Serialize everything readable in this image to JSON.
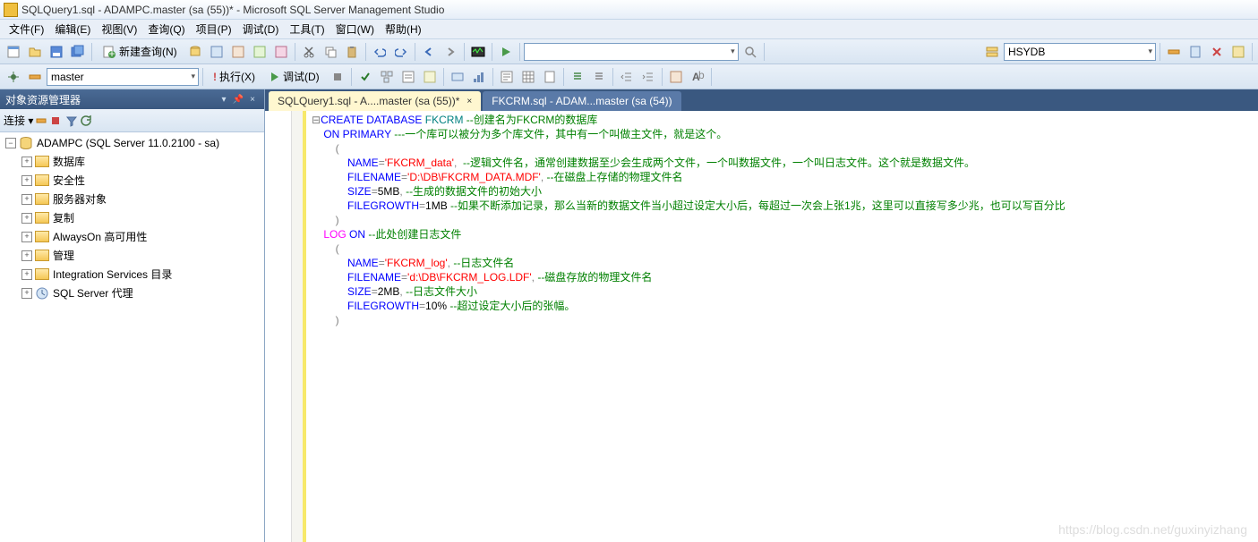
{
  "window": {
    "title": "SQLQuery1.sql - ADAMPC.master (sa (55))* - Microsoft SQL Server Management Studio"
  },
  "menu": {
    "file": "文件(F)",
    "edit": "编辑(E)",
    "view": "视图(V)",
    "query": "查询(Q)",
    "project": "项目(P)",
    "debug": "调试(D)",
    "tools": "工具(T)",
    "window": "窗口(W)",
    "help": "帮助(H)"
  },
  "toolbar1": {
    "new_query": "新建查询(N)",
    "db_combo": "HSYDB"
  },
  "toolbar2": {
    "db_context": "master",
    "execute": "执行(X)",
    "debug": "调试(D)"
  },
  "sidebar": {
    "title": "对象资源管理器",
    "connect_label": "连接 ▾",
    "server": "ADAMPC (SQL Server 11.0.2100 - sa)",
    "nodes": {
      "databases": "数据库",
      "security": "安全性",
      "server_objects": "服务器对象",
      "replication": "复制",
      "alwayson": "AlwaysOn 高可用性",
      "management": "管理",
      "integration": "Integration Services 目录",
      "agent": "SQL Server 代理"
    }
  },
  "tabs": {
    "active": "SQLQuery1.sql - A....master (sa (55))*",
    "inactive": "FKCRM.sql - ADAM...master (sa (54))"
  },
  "code": {
    "l1_create": "CREATE",
    "l1_database": " DATABASE",
    "l1_fkcrm": " FKCRM",
    "l1_c": " --创建名为FKCRM的数据库",
    "l2_on": "ON",
    "l2_primary": " PRIMARY",
    "l2_c": " ---一个库可以被分为多个库文件，其中有一个叫做主文件，就是这个。",
    "l3": "(",
    "l4_name": "NAME",
    "l4_eq": "=",
    "l4_val": "'FKCRM_data'",
    "l4_comma": ",",
    "l4_c": "  --逻辑文件名，通常创建数据至少会生成两个文件，一个叫数据文件，一个叫日志文件。这个就是数据文件。",
    "l5_fn": "FILENAME",
    "l5_eq": "=",
    "l5_val": "'D:\\DB\\FKCRM_DATA.MDF'",
    "l5_comma": ",",
    "l5_c": " --在磁盘上存储的物理文件名",
    "l6_size": "SIZE",
    "l6_eq": "=",
    "l6_val": "5MB",
    "l6_comma": ",",
    "l6_c": " --生成的数据文件的初始大小",
    "l7_fg": "FILEGROWTH",
    "l7_eq": "=",
    "l7_val": "1MB",
    "l7_c": " --如果不断添加记录，那么当新的数据文件当小超过设定大小后，每超过一次会上张1兆，这里可以直接写多少兆，也可以写百分比",
    "l8": ")",
    "l9_log": "LOG",
    "l9_on": " ON",
    "l9_c": " --此处创建日志文件",
    "l10": "(",
    "l11_name": "NAME",
    "l11_eq": "=",
    "l11_val": "'FKCRM_log'",
    "l11_comma": ",",
    "l11_c": " --日志文件名",
    "l12_fn": "FILENAME",
    "l12_eq": "=",
    "l12_val": "'d:\\DB\\FKCRM_LOG.LDF'",
    "l12_comma": ",",
    "l12_c": " --磁盘存放的物理文件名",
    "l13_size": "SIZE",
    "l13_eq": "=",
    "l13_val": "2MB",
    "l13_comma": ",",
    "l13_c": " --日志文件大小",
    "l14_fg": "FILEGROWTH",
    "l14_eq": "=",
    "l14_val": "10%",
    "l14_c": " --超过设定大小后的张幅。",
    "l15": ")"
  },
  "watermark": "https://blog.csdn.net/guxinyizhang"
}
